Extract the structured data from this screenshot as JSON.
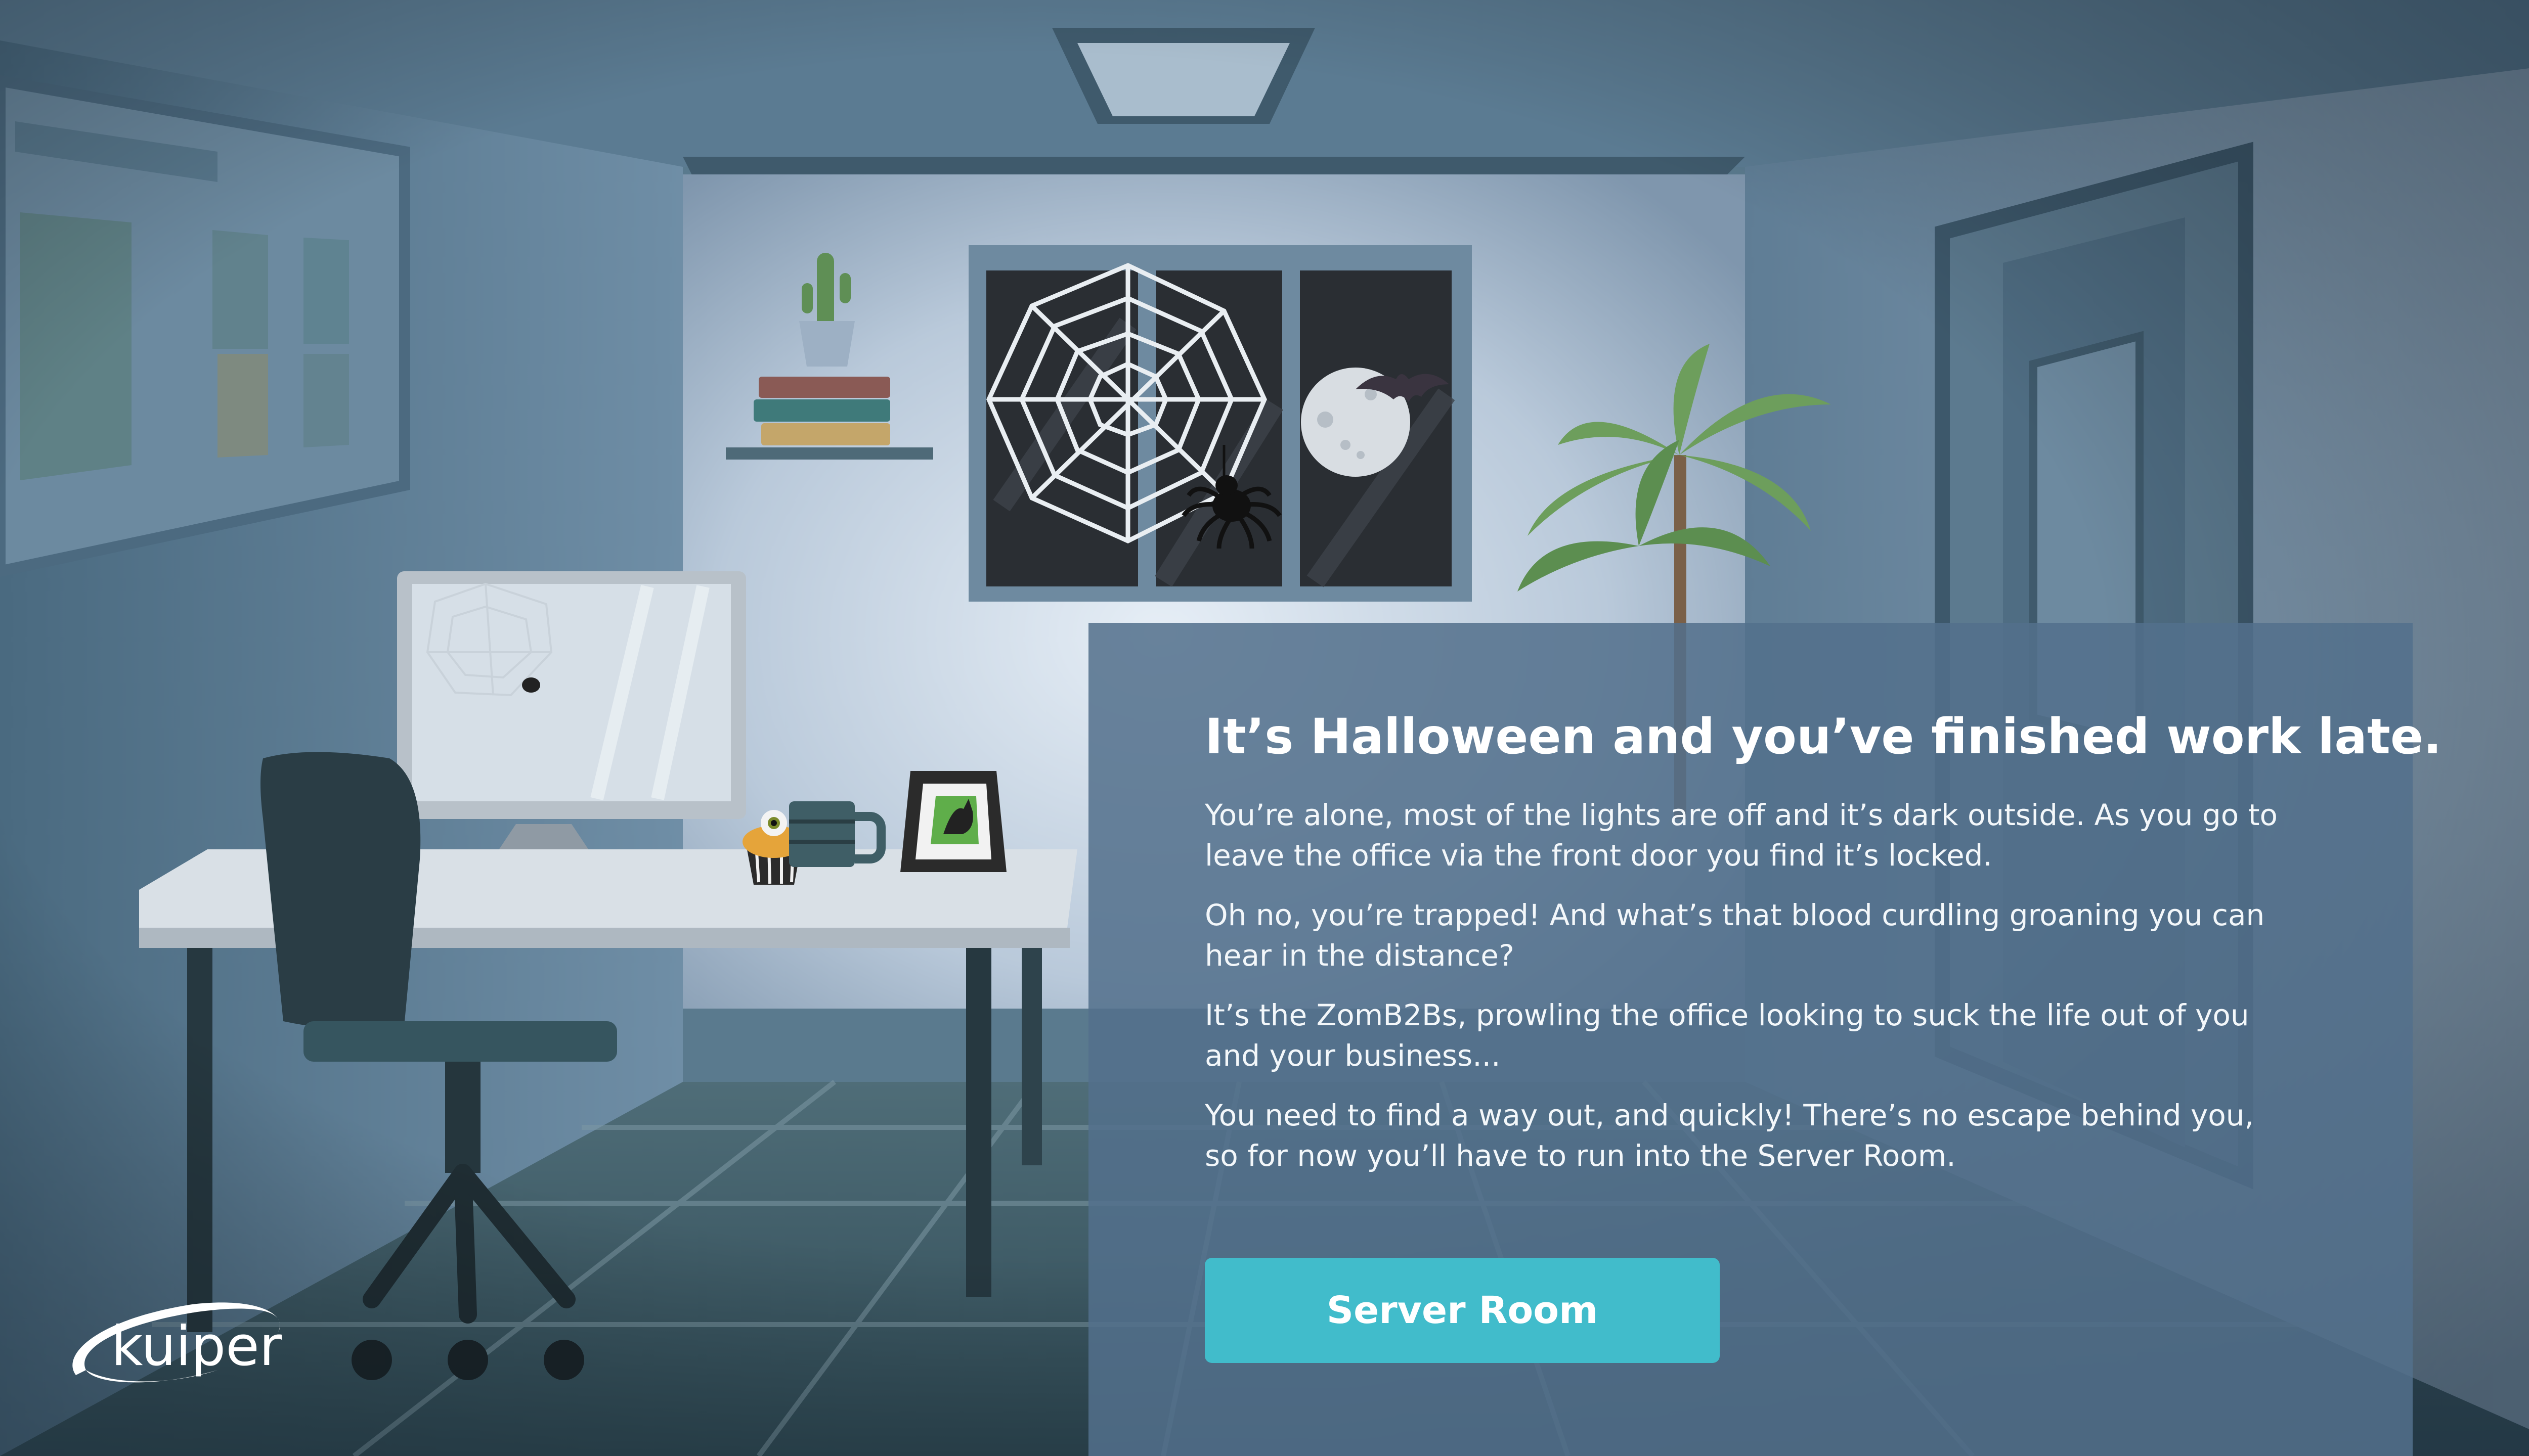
{
  "story": {
    "title": "It’s Halloween and you’ve finished work late.",
    "paragraphs": [
      "You’re alone, most of the lights are off and it’s dark outside. As you go to leave the office via the front door you find it’s locked.",
      "Oh no, you’re trapped! And what’s that blood curdling groaning you can hear in the distance?",
      "It’s the ZomB2Bs, prowling the office looking to suck the life out of you and your business...",
      "You need to find a way out, and quickly! There’s no escape behind you, so for now you’ll have to run into the Server Room."
    ],
    "button_label": "Server Room"
  },
  "logo": {
    "text": "kuiper"
  },
  "colors": {
    "button": "#41bccb",
    "panel": "#53708c",
    "wall": "#c9d6e4",
    "floor": "#3e5a66"
  },
  "icons": [
    "spider-web-icon",
    "spider-icon",
    "moon-icon",
    "bat-icon",
    "cactus-icon",
    "palm-plant-icon",
    "cupcake-icon",
    "mug-icon",
    "photo-frame-icon"
  ]
}
